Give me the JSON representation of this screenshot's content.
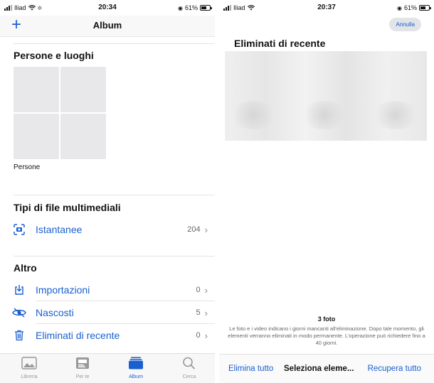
{
  "left": {
    "status": {
      "carrier": "Iliad",
      "time": "20:34",
      "battery": "61%"
    },
    "nav": {
      "add_icon": "plus-icon",
      "title": "Album"
    },
    "people_places": {
      "title": "Persone e luoghi",
      "label": "Persone"
    },
    "media_types": {
      "title": "Tipi di file multimediali",
      "items": [
        {
          "label": "Istantanee",
          "count": "204",
          "icon": "screenshot-icon"
        }
      ]
    },
    "other": {
      "title": "Altro",
      "items": [
        {
          "label": "Importazioni",
          "count": "0",
          "icon": "import-icon"
        },
        {
          "label": "Nascosti",
          "count": "5",
          "icon": "eye-slash-icon"
        },
        {
          "label": "Eliminati di recente",
          "count": "0",
          "icon": "trash-icon"
        }
      ]
    },
    "tabbar": {
      "items": [
        {
          "label": "Libreria",
          "icon": "photo-library-icon"
        },
        {
          "label": "Per te",
          "icon": "for-you-icon"
        },
        {
          "label": "Album",
          "icon": "album-icon"
        },
        {
          "label": "Cerca",
          "icon": "search-icon"
        }
      ],
      "active": "Album"
    }
  },
  "right": {
    "status": {
      "carrier": "Iliad",
      "time": "20:37",
      "battery": "61%"
    },
    "cancel": "Annulla",
    "title": "Eliminati di recente",
    "footer_count": "3 foto",
    "footer_text": "Le foto e i video indicano i giorni mancanti all'eliminazione. Dopo tale momento, gli elementi verranno eliminati in modo permanente. L'operazione può richiedere fino a 40 giorni.",
    "actions": {
      "delete_all": "Elimina tutto",
      "select": "Seleziona eleme...",
      "recover_all": "Recupera tutto"
    }
  },
  "colors": {
    "accent": "#1a5fd0"
  }
}
